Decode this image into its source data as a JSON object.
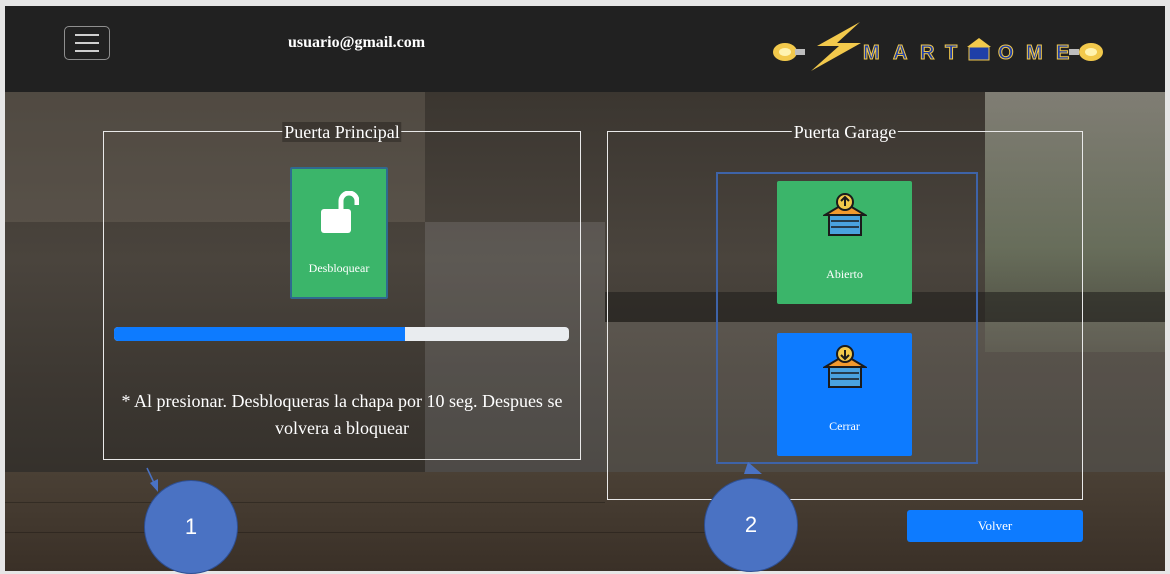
{
  "header": {
    "menu_icon": "hamburger-icon",
    "user_email": "usuario@gmail.com",
    "logo_text": "SMARTHOME"
  },
  "panel_main_door": {
    "title": "Puerta Principal",
    "unlock_button": {
      "label": "Desbloquear",
      "icon": "unlocked-padlock-icon",
      "color": "#3bb56a"
    },
    "progress_fraction": 0.64,
    "note": "* Al presionar. Desbloqueras la chapa por 10 seg. Despues se volvera a bloquear"
  },
  "panel_garage_door": {
    "title": "Puerta Garage",
    "open_button": {
      "label": "Abierto",
      "icon": "garage-open-icon",
      "color": "#3bb56a"
    },
    "close_button": {
      "label": "Cerrar",
      "icon": "garage-close-icon",
      "color": "#0d7bff"
    }
  },
  "callouts": [
    "1",
    "2"
  ],
  "back_button": {
    "label": "Volver",
    "color": "#0d7bff"
  }
}
